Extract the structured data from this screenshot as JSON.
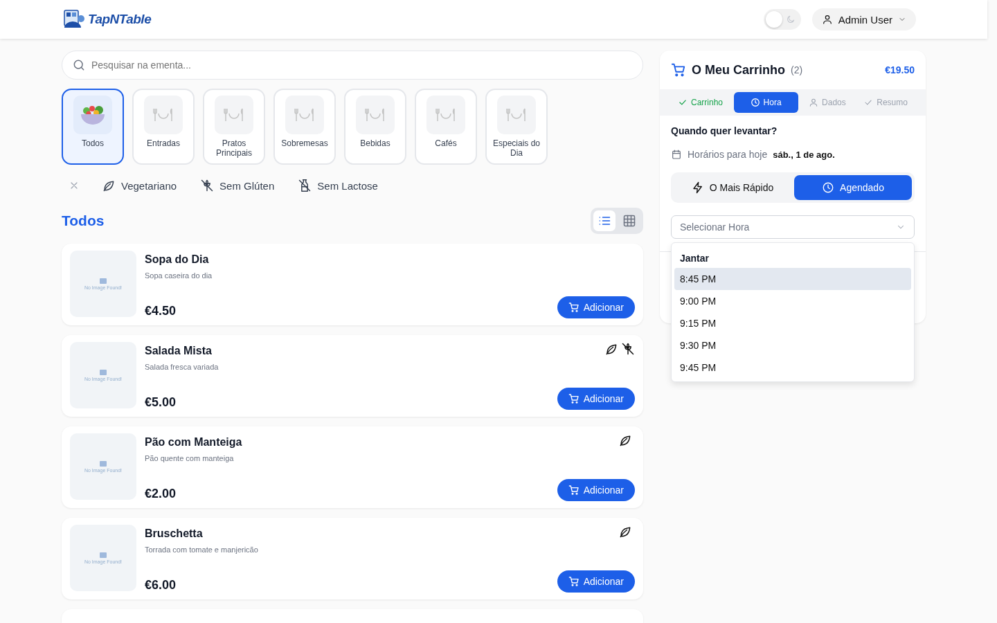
{
  "header": {
    "logo": "TapNTable",
    "dark_mode": {
      "on": false
    },
    "user": "Admin User"
  },
  "search": {
    "placeholder": "Pesquisar na ementa..."
  },
  "categories": [
    {
      "label": "Todos",
      "kind": "salad",
      "selected": true
    },
    {
      "label": "Entradas",
      "kind": "placeholder",
      "selected": false
    },
    {
      "label": "Pratos Principais",
      "kind": "placeholder",
      "selected": false
    },
    {
      "label": "Sobremesas",
      "kind": "placeholder",
      "selected": false
    },
    {
      "label": "Bebidas",
      "kind": "placeholder",
      "selected": false
    },
    {
      "label": "Cafés",
      "kind": "placeholder",
      "selected": false
    },
    {
      "label": "Especiais do Dia",
      "kind": "placeholder",
      "selected": false
    }
  ],
  "filters": [
    {
      "label": "Vegetariano",
      "kind": "vegetarian",
      "selected": false
    },
    {
      "label": "Sem Glúten",
      "kind": "gluten_free",
      "selected": false
    },
    {
      "label": "Sem Lactose",
      "kind": "lactose_free",
      "selected": false
    }
  ],
  "section_title": "Todos",
  "view_modes": [
    {
      "kind": "list",
      "selected": true
    },
    {
      "kind": "grid",
      "selected": false
    }
  ],
  "items": [
    {
      "name": "Sopa do Dia",
      "description": "Sopa caseira do dia",
      "price": "€4.50",
      "image_text": "No Image Found!",
      "vegetarian": false,
      "gluten_free": false,
      "button": "Adicionar"
    },
    {
      "name": "Salada Mista",
      "description": "Salada fresca variada",
      "price": "€5.00",
      "image_text": "No Image Found!",
      "vegetarian": true,
      "gluten_free": true,
      "button": "Adicionar"
    },
    {
      "name": "Pão com Manteiga",
      "description": "Pão quente com manteiga",
      "price": "€2.00",
      "image_text": "No Image Found!",
      "vegetarian": true,
      "gluten_free": false,
      "button": "Adicionar"
    },
    {
      "name": "Bruschetta",
      "description": "Torrada com tomate e manjericão",
      "price": "€6.00",
      "image_text": "No Image Found!",
      "vegetarian": true,
      "gluten_free": false,
      "button": "Adicionar"
    }
  ],
  "cart": {
    "title": "O Meu Carrinho",
    "count": "(2)",
    "total": "€19.50",
    "steps": [
      {
        "label": "Carrinho",
        "kind": "cart",
        "done": true,
        "selected": false
      },
      {
        "label": "Hora",
        "kind": "time",
        "selected": true
      },
      {
        "label": "Dados",
        "kind": "details",
        "done": false,
        "selected": false
      },
      {
        "label": "Resumo",
        "kind": "summary",
        "done": false,
        "selected": false
      }
    ],
    "question": "Quando quer levantar?",
    "schedule_label": "Horários para hoje",
    "schedule_date": "sáb., 1 de ago.",
    "modes": [
      {
        "label": "O Mais Rápido",
        "kind": "fast",
        "selected": false
      },
      {
        "label": "Agendado",
        "kind": "scheduled",
        "selected": true
      }
    ],
    "time_select": {
      "placeholder": "Selecionar Hora",
      "expanded": true
    },
    "time_group": "Jantar",
    "time_options": [
      {
        "label": "8:45 PM",
        "selected": true
      },
      {
        "label": "9:00 PM",
        "selected": false
      },
      {
        "label": "9:15 PM",
        "selected": false
      },
      {
        "label": "9:30 PM",
        "selected": false
      },
      {
        "label": "9:45 PM",
        "selected": false
      }
    ]
  }
}
